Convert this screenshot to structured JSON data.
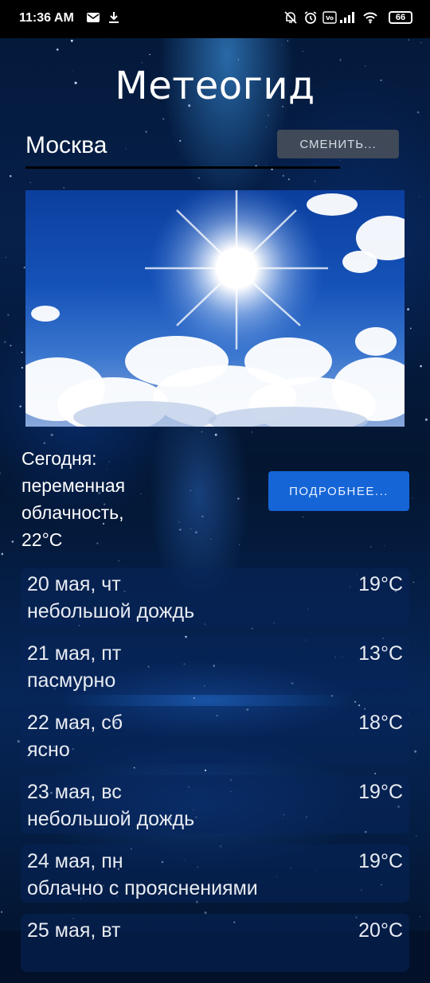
{
  "status_bar": {
    "time": "11:36 AM",
    "battery": "66",
    "icons": [
      "mail-icon",
      "download-icon",
      "mute-icon",
      "alarm-icon",
      "volte-icon",
      "signal-icon",
      "wifi-icon",
      "battery-icon"
    ]
  },
  "app": {
    "title": "Метеогид"
  },
  "city": {
    "name": "Москва",
    "change_label": "СМЕНИТЬ..."
  },
  "today": {
    "line1": "Сегодня:",
    "line2": "переменная",
    "line3": "облачность,",
    "line4": "22°C",
    "details_label": "ПОДРОБНЕЕ..."
  },
  "forecast": [
    {
      "date": "20 мая, чт",
      "desc": "небольшой дождь",
      "temp": "19°C"
    },
    {
      "date": "21 мая, пт",
      "desc": "пасмурно",
      "temp": "13°C"
    },
    {
      "date": "22 мая, сб",
      "desc": "ясно",
      "temp": "18°C"
    },
    {
      "date": "23 мая, вс",
      "desc": "небольшой дождь",
      "temp": "19°C"
    },
    {
      "date": "24 мая, пн",
      "desc": "облачно с прояснениями",
      "temp": "19°C"
    },
    {
      "date": "25 мая, вт",
      "desc": "",
      "temp": "20°C"
    }
  ],
  "colors": {
    "accent_button": "#1565d6",
    "secondary_button": "#464e5a",
    "background": "#041838"
  }
}
